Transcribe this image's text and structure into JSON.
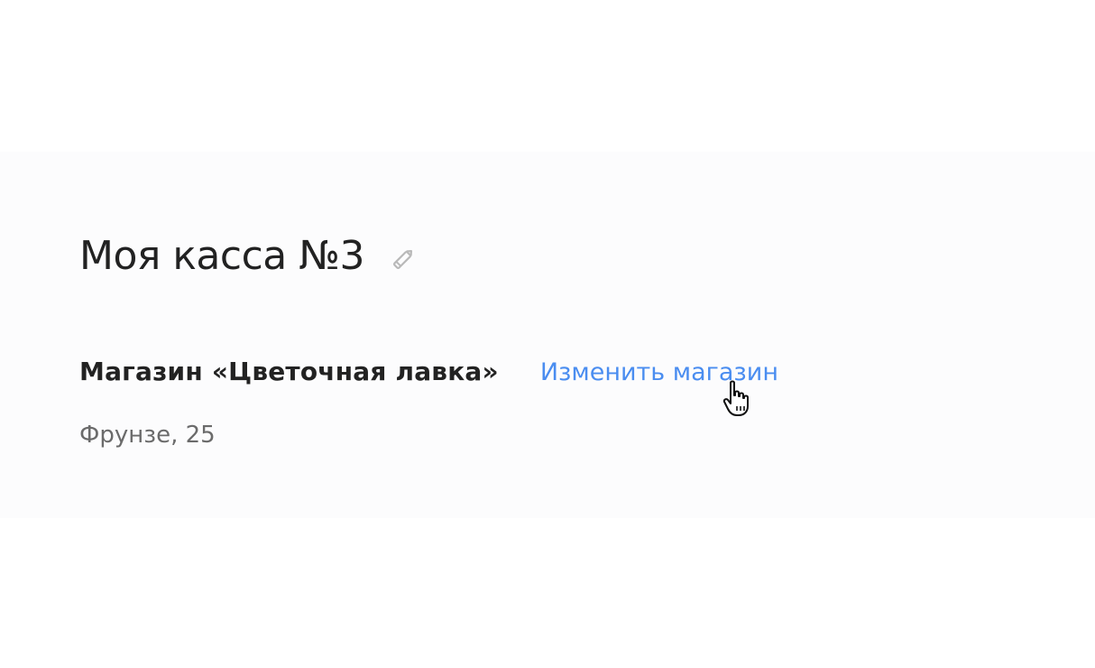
{
  "kassa": {
    "title": "Моя касса №3",
    "edit_icon": "pencil-icon"
  },
  "store": {
    "name": "Магазин «Цветочная лавка»",
    "change_link": "Изменить магазин",
    "address": "Фрунзе, 25"
  },
  "cursor": {
    "icon": "hand-pointer-icon"
  },
  "colors": {
    "title": "#222222",
    "link": "#4a8df0",
    "address": "#6b6b6b",
    "panel_bg": "#fcfcfd",
    "icon": "#b9b9b9"
  }
}
